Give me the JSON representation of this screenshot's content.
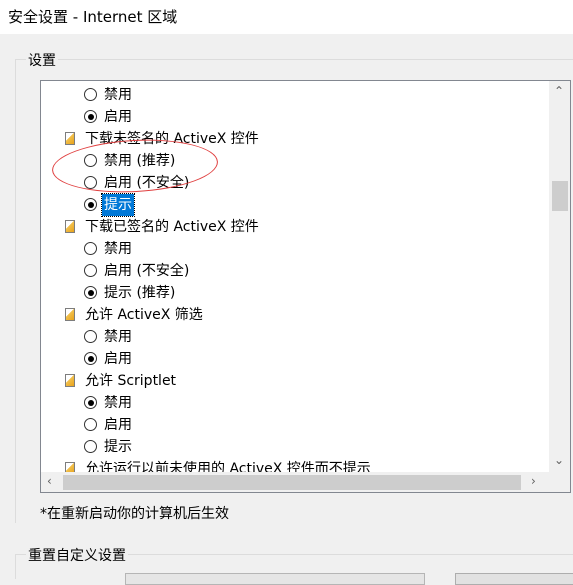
{
  "window": {
    "title": "安全设置 - Internet 区域"
  },
  "settings_group": {
    "label": "设置"
  },
  "list": {
    "rows": [
      {
        "type": "radio",
        "label": "禁用",
        "checked": false
      },
      {
        "type": "radio",
        "label": "启用",
        "checked": true
      },
      {
        "type": "category",
        "label": "下载未签名的 ActiveX 控件"
      },
      {
        "type": "radio",
        "label": "禁用 (推荐)",
        "checked": false
      },
      {
        "type": "radio",
        "label": "启用 (不安全)",
        "checked": false
      },
      {
        "type": "radio",
        "label": "提示",
        "checked": true,
        "selected": true
      },
      {
        "type": "category",
        "label": "下载已签名的 ActiveX 控件"
      },
      {
        "type": "radio",
        "label": "禁用",
        "checked": false
      },
      {
        "type": "radio",
        "label": "启用 (不安全)",
        "checked": false
      },
      {
        "type": "radio",
        "label": "提示 (推荐)",
        "checked": true
      },
      {
        "type": "category",
        "label": "允许 ActiveX 筛选"
      },
      {
        "type": "radio",
        "label": "禁用",
        "checked": false
      },
      {
        "type": "radio",
        "label": "启用",
        "checked": true
      },
      {
        "type": "category",
        "label": "允许 Scriptlet"
      },
      {
        "type": "radio",
        "label": "禁用",
        "checked": true
      },
      {
        "type": "radio",
        "label": "启用",
        "checked": false
      },
      {
        "type": "radio",
        "label": "提示",
        "checked": false
      },
      {
        "type": "category",
        "label": "允许运行以前未使用的 ActiveX 控件而不提示"
      }
    ]
  },
  "footnote": "*在重新启动你的计算机后生效",
  "reset_group": {
    "label": "重置自定义设置"
  },
  "icons": {
    "scroll_up": "up-arrow-icon",
    "scroll_down": "down-arrow-icon",
    "scroll_left": "left-arrow-icon",
    "scroll_right": "right-arrow-icon"
  },
  "colors": {
    "selection": "#0078d7",
    "annotation": "#e04040"
  }
}
